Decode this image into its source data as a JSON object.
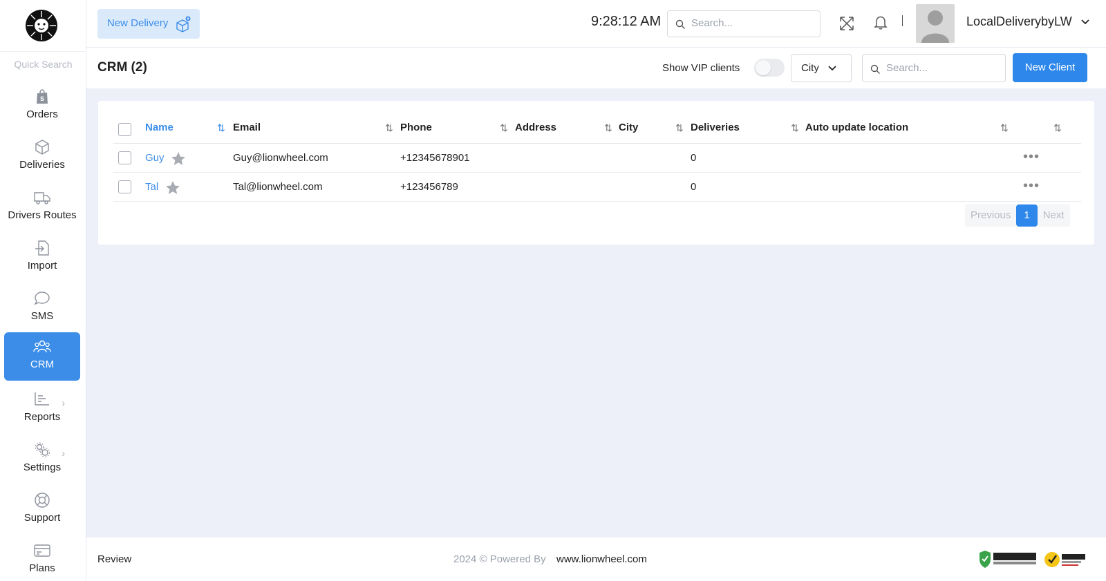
{
  "sidebar": {
    "quick_search": "Quick Search",
    "items": [
      {
        "label": "Orders",
        "icon": "shopify-bag-icon"
      },
      {
        "label": "Deliveries",
        "icon": "box-icon"
      },
      {
        "label": "Drivers Routes",
        "icon": "truck-icon"
      },
      {
        "label": "Import",
        "icon": "import-icon"
      },
      {
        "label": "SMS",
        "icon": "chat-bubble-icon"
      },
      {
        "label": "CRM",
        "icon": "users-icon",
        "active": true
      },
      {
        "label": "Reports",
        "icon": "chart-icon"
      },
      {
        "label": "Settings",
        "icon": "gears-icon"
      },
      {
        "label": "Support",
        "icon": "lifebuoy-icon"
      },
      {
        "label": "Plans",
        "icon": "card-icon"
      }
    ]
  },
  "header": {
    "new_delivery": "New Delivery",
    "clock": "9:28:12 AM",
    "search_placeholder": "Search...",
    "account_name": "LocalDeliverybyLW"
  },
  "subheader": {
    "title": "CRM (2)",
    "vip_label": "Show VIP clients",
    "vip_enabled": false,
    "city_select": "City",
    "search_placeholder": "Search...",
    "new_client": "New Client"
  },
  "table": {
    "columns": [
      "Name",
      "Email",
      "Phone",
      "Address",
      "City",
      "Deliveries",
      "Auto update location"
    ],
    "rows": [
      {
        "name": "Guy",
        "email": "Guy@lionwheel.com",
        "phone": "+12345678901",
        "address": "",
        "city": "",
        "deliveries": "0",
        "auto_update": ""
      },
      {
        "name": "Tal",
        "email": "Tal@lionwheel.com",
        "phone": "+123456789",
        "address": "",
        "city": "",
        "deliveries": "0",
        "auto_update": ""
      }
    ]
  },
  "pagination": {
    "previous": "Previous",
    "current": "1",
    "next": "Next"
  },
  "footer": {
    "review": "Review",
    "powered_by": "2024 © Powered By",
    "powered_link": "www.lionwheel.com"
  },
  "colors": {
    "accent": "#2e87ea",
    "active_nav": "#3b8de8",
    "page_bg": "#edf0f8"
  }
}
